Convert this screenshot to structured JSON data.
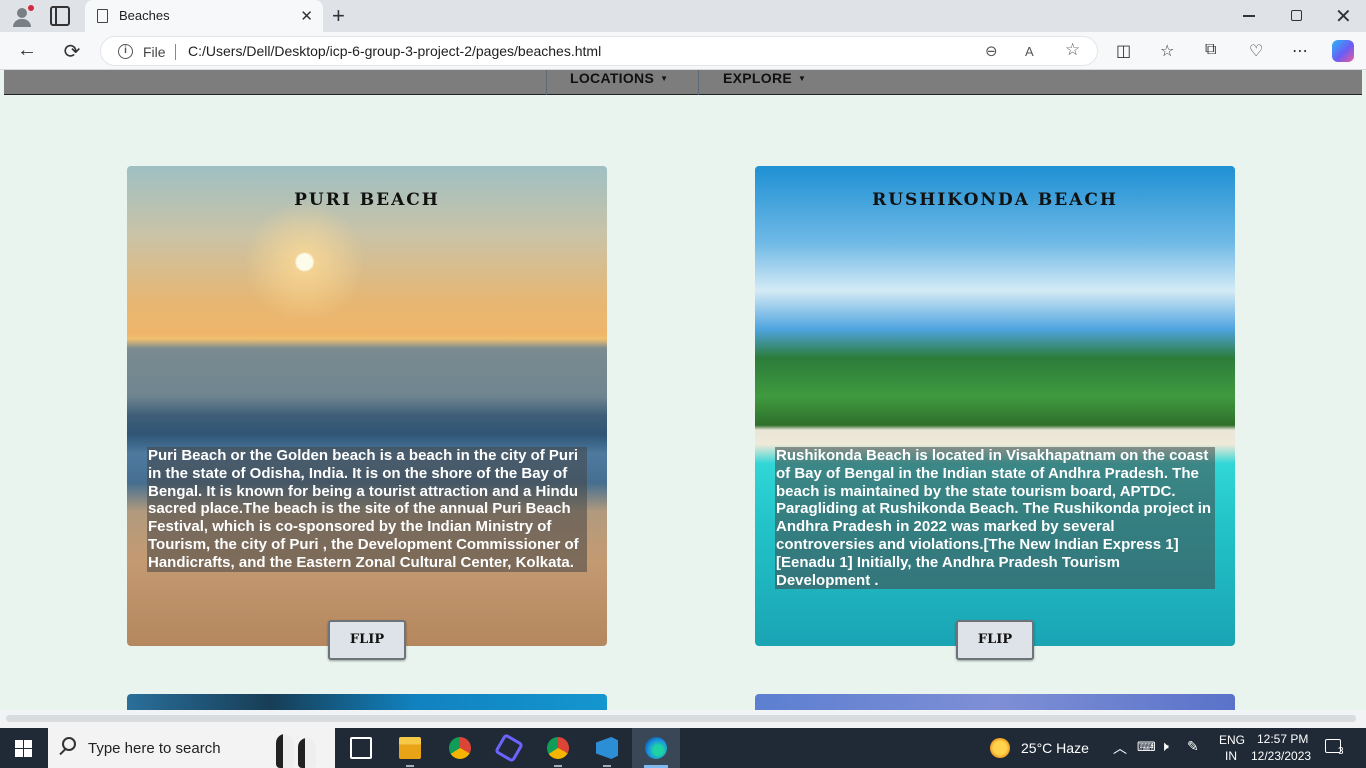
{
  "browser": {
    "tab_title": "Beaches",
    "tab_close": "✕",
    "new_tab": "+",
    "file_label": "File",
    "url": "C:/Users/Dell/Desktop/icp-6-group-3-project-2/pages/beaches.html",
    "window_close": "✕",
    "back": "←",
    "refresh": "⟳",
    "more": "⋯"
  },
  "site_nav": {
    "items": [
      {
        "label": "LOCATIONS",
        "caret": "▼"
      },
      {
        "label": "EXPLORE",
        "caret": "▼"
      }
    ]
  },
  "cards": [
    {
      "title": "PURI BEACH",
      "text": "Puri Beach or the Golden beach is a beach in the city of Puri in the state of Odisha, India. It is on the shore of the Bay of Bengal. It is known for being a tourist attraction and a Hindu sacred place.The beach is the site of the annual Puri Beach Festival, which is co-sponsored by the Indian Ministry of Tourism, the city of Puri , the Development Commissioner of Handicrafts, and the Eastern Zonal Cultural Center, Kolkata.",
      "button": "FLIP"
    },
    {
      "title": "RUSHIKONDA BEACH",
      "text": "Rushikonda Beach is located in Visakhapatnam on the coast of Bay of Bengal in the Indian state of Andhra Pradesh. The beach is maintained by the state tourism board, APTDC. Paragliding at Rushikonda Beach. The Rushikonda project in Andhra Pradesh in 2022 was marked by several controversies and violations.[The New Indian Express 1][Eenadu 1] Initially, the Andhra Pradesh Tourism Development .",
      "button": "FLIP"
    }
  ],
  "taskbar": {
    "search_placeholder": "Type here to search",
    "weather": "25°C  Haze",
    "lang_top": "ENG",
    "lang_bottom": "IN",
    "time": "12:57 PM",
    "date": "12/23/2023",
    "notifications": "3"
  },
  "colors": {
    "page_bg": "#e9f4ee",
    "site_nav_bg": "#7d7d7d",
    "taskbar_bg": "#1f2a36"
  }
}
